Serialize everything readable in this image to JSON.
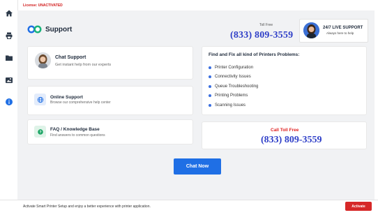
{
  "license": {
    "text": "License: UNACTIVATED"
  },
  "sidebar": {
    "items": [
      {
        "name": "home-icon"
      },
      {
        "name": "printer-icon"
      },
      {
        "name": "folder-icon"
      },
      {
        "name": "image-icon"
      },
      {
        "name": "info-icon"
      }
    ]
  },
  "header": {
    "title": "Support",
    "toll_free_label": "Toll Free",
    "toll_free_number": "(833) 809-3559",
    "support_card": {
      "title": "24/7 LIVE SUPPORT",
      "subtitle": "Always here to help"
    }
  },
  "options": [
    {
      "title": "Chat Support",
      "subtitle": "Get instant help from our experts"
    },
    {
      "title": "Online Support",
      "subtitle": "Browse our comprehensive help center"
    },
    {
      "title": "FAQ / Knowledge Base",
      "subtitle": "Find answers to common questions"
    }
  ],
  "problems": {
    "title": "Find and Fix all kind of Printers Problems:",
    "items": [
      "Printer Configuration",
      "Connectivity Issues",
      "Queue Troubleshooting",
      "Printing Problems",
      "Scanning Issues"
    ]
  },
  "call": {
    "label": "Call Toll Free",
    "number": "(833) 809-3559"
  },
  "chat_now_label": "Chat Now",
  "footer": {
    "text": "Activate Smart Printer Setup and enjoy a better experience with printer application.",
    "activate_label": "Activate"
  },
  "colors": {
    "accent": "#1f6fe5",
    "phone": "#2f3fc8",
    "alert": "#d62828",
    "license": "#d11a1a"
  }
}
